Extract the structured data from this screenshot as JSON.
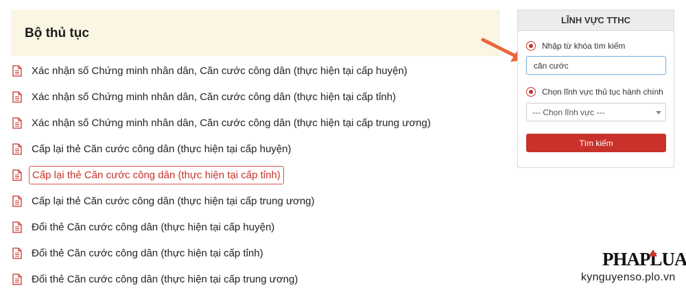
{
  "page": {
    "title": "Bộ thủ tục"
  },
  "procedures": [
    {
      "label": "Xác nhận số Chứng minh nhân dân, Căn cước công dân (thực hiện tại cấp huyện)",
      "icon": "document-icon"
    },
    {
      "label": "Xác nhận số Chứng minh nhân dân, Căn cước công dân (thực hiện tại cấp tỉnh)",
      "icon": "document-icon"
    },
    {
      "label": "Xác nhận số Chứng minh nhân dân, Căn cước công dân (thực hiện tại cấp trung ương)",
      "icon": "document-icon"
    },
    {
      "label": "Cấp lại thẻ Căn cước công dân (thực hiện tại cấp huyện)",
      "icon": "document-icon"
    },
    {
      "label": "Cấp lại thẻ Căn cước công dân (thực hiện tại cấp tỉnh)",
      "icon": "document-icon",
      "highlighted": true
    },
    {
      "label": "Cấp lại thẻ Căn cước công dân (thực hiện tại cấp trung ương)",
      "icon": "document-icon"
    },
    {
      "label": "Đổi thẻ Căn cước công dân (thực hiện tại cấp huyện)",
      "icon": "document-icon"
    },
    {
      "label": "Đổi thẻ Căn cước công dân (thực hiện tại cấp tỉnh)",
      "icon": "document-icon"
    },
    {
      "label": "Đổi thẻ Căn cước công dân (thực hiện tại cấp trung ương)",
      "icon": "document-icon"
    }
  ],
  "panel": {
    "title": "LĨNH VỰC TTHC",
    "keyword_option": "Nhập từ khóa tìm kiếm",
    "keyword_value": "căn cước",
    "field_option": "Chọn lĩnh vực thủ tục hành chính",
    "field_select_value": "--- Chọn lĩnh vực ---",
    "search_button": "Tìm kiếm"
  },
  "watermark": {
    "logo_text": "PHAPLUAT",
    "source": "kynguyenso.plo.vn"
  },
  "colors": {
    "accent": "#c8322a",
    "header_bg": "#faf6e3",
    "arrow": "#e8673a"
  }
}
